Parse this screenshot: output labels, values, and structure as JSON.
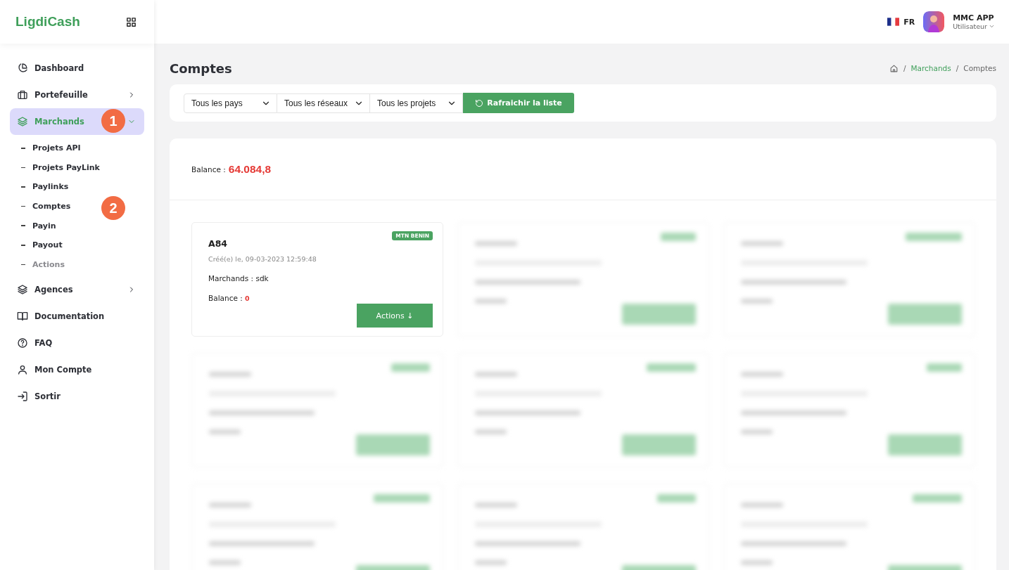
{
  "brand": {
    "name": "LigdiCash"
  },
  "sidebar": {
    "items": [
      {
        "label": "Dashboard",
        "selected": false
      },
      {
        "label": "Portefeuille",
        "selected": false,
        "expanded": false
      },
      {
        "label": "Marchands",
        "selected": true,
        "expanded": true,
        "children": [
          {
            "label": "Projets API",
            "dimmed": false
          },
          {
            "label": "Projets PayLink",
            "dimmed": false
          },
          {
            "label": "Paylinks",
            "dimmed": false
          },
          {
            "label": "Comptes",
            "dimmed": false
          },
          {
            "label": "Payin",
            "dimmed": false
          },
          {
            "label": "Payout",
            "dimmed": false
          },
          {
            "label": "Actions",
            "dimmed": true
          }
        ]
      },
      {
        "label": "Agences",
        "selected": false,
        "expanded": false
      },
      {
        "label": "Documentation",
        "selected": false
      },
      {
        "label": "FAQ",
        "selected": false
      },
      {
        "label": "Mon Compte",
        "selected": false
      },
      {
        "label": "Sortir",
        "selected": false
      }
    ]
  },
  "annotations": [
    "1",
    "2"
  ],
  "header": {
    "language": "FR",
    "user_name": "MMC APP",
    "user_role": "Utilisateur"
  },
  "page": {
    "title": "Comptes",
    "breadcrumb_separator": "/",
    "breadcrumb": [
      "Marchands",
      "Comptes"
    ]
  },
  "filters": {
    "dropdowns": [
      "Tous les pays",
      "Tous les réseaux",
      "Tous les projets"
    ],
    "refresh_button": "Rafraichir la liste"
  },
  "summary": {
    "label": "Balance :",
    "value": "64.084,8"
  },
  "cards": [
    {
      "kind": "account",
      "id": "A84",
      "network": "MTN BENIN",
      "created": "Créé(e) le, 09-03-2023 12:59:48",
      "merchant_label": "Marchands : sdk",
      "balance_label": "Balance :",
      "balance": "0",
      "action": "Actions ↓"
    },
    {
      "kind": "blurred"
    },
    {
      "kind": "blurred"
    },
    {
      "kind": "blurred"
    },
    {
      "kind": "blurred"
    },
    {
      "kind": "blurred"
    },
    {
      "kind": "blurred"
    },
    {
      "kind": "blurred"
    },
    {
      "kind": "blurred"
    }
  ]
}
